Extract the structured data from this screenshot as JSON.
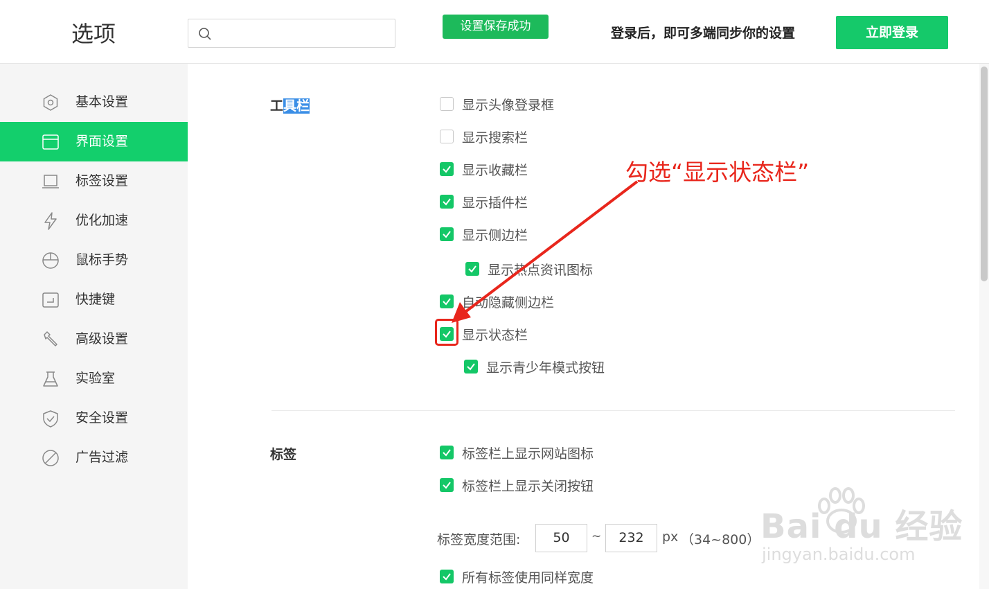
{
  "header": {
    "title": "选项",
    "search_placeholder": "",
    "toast": "设置保存成功",
    "login_tip": "登录后，即可多端同步你的设置",
    "login_button": "立即登录"
  },
  "sidebar": {
    "items": [
      {
        "label": "基本设置",
        "icon": "gear-icon",
        "active": false
      },
      {
        "label": "界面设置",
        "icon": "window-icon",
        "active": true
      },
      {
        "label": "标签设置",
        "icon": "tab-icon",
        "active": false
      },
      {
        "label": "优化加速",
        "icon": "lightning-icon",
        "active": false
      },
      {
        "label": "鼠标手势",
        "icon": "mouse-icon",
        "active": false
      },
      {
        "label": "快捷键",
        "icon": "shortcut-icon",
        "active": false
      },
      {
        "label": "高级设置",
        "icon": "wrench-icon",
        "active": false
      },
      {
        "label": "实验室",
        "icon": "flask-icon",
        "active": false
      },
      {
        "label": "安全设置",
        "icon": "shield-icon",
        "active": false
      },
      {
        "label": "广告过滤",
        "icon": "block-icon",
        "active": false
      }
    ]
  },
  "toolbar_section": {
    "title_prefix": "工",
    "title_selected": "具栏",
    "options": [
      {
        "label": "显示头像登录框",
        "checked": false
      },
      {
        "label": "显示搜索栏",
        "checked": false
      },
      {
        "label": "显示收藏栏",
        "checked": true
      },
      {
        "label": "显示插件栏",
        "checked": true
      },
      {
        "label": "显示侧边栏",
        "checked": true
      },
      {
        "label": "显示热点资讯图标",
        "checked": true
      },
      {
        "label": "自动隐藏侧边栏",
        "checked": true
      },
      {
        "label": "显示状态栏",
        "checked": true
      },
      {
        "label": "显示青少年模式按钮",
        "checked": true
      }
    ]
  },
  "tabs_section": {
    "title": "标签",
    "options": [
      {
        "label": "标签栏上显示网站图标",
        "checked": true
      },
      {
        "label": "标签栏上显示关闭按钮",
        "checked": true
      },
      {
        "label": "所有标签使用同样宽度",
        "checked": true
      }
    ],
    "width_range": {
      "label": "标签宽度范围:",
      "min": "50",
      "separator": "~",
      "max": "232",
      "unit": "px",
      "limits": "（34~800）"
    }
  },
  "annotation": {
    "text": "勾选“显示状态栏”",
    "color": "#e8261c"
  },
  "watermark": {
    "brand": "Bai du 经验",
    "url": "jingyan.baidu.com"
  },
  "colors": {
    "accent": "#13cf6c",
    "toast": "#1dba5b",
    "checkbox": "#14c767",
    "annotation": "#e8261c"
  }
}
